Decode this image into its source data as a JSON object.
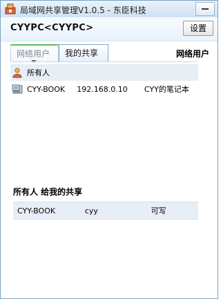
{
  "window": {
    "title": "局域网共享管理V1.0.5 - 东臣科技",
    "minimize_icon": "minimize-icon"
  },
  "topbar": {
    "host": "CYYPC<CYYPC>",
    "settings_label": "设置"
  },
  "tabs": [
    {
      "label": "网络用户",
      "active": true
    },
    {
      "label": "我的共享",
      "active": false
    }
  ],
  "right_heading": "网络用户",
  "users": [
    {
      "name": "所有人",
      "ip": "",
      "desc": "",
      "icon": "users-group-icon",
      "selected": true
    },
    {
      "name": "CYY-BOOK",
      "ip": "192.168.0.10",
      "desc": "CYY的笔记本",
      "icon": "computer-icon",
      "selected": false
    }
  ],
  "share_section": {
    "title": "所有人 给我的共享",
    "rows": [
      {
        "host": "CYY-BOOK",
        "user": "cyy",
        "perm": "可写"
      }
    ]
  },
  "colors": {
    "accent_green": "#5bbd5b",
    "selection": "#e7eef6"
  }
}
